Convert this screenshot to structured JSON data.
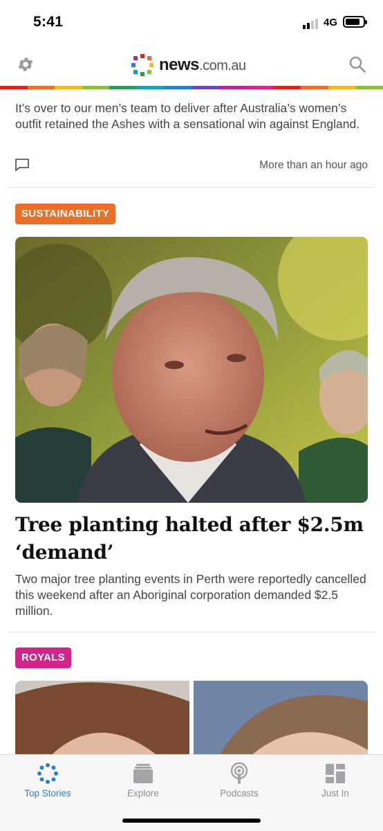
{
  "status_bar": {
    "time": "5:41",
    "network": "4G",
    "signal_bars_filled": 2,
    "battery_level": 0.85
  },
  "header": {
    "logo_main": "news",
    "logo_suffix": ".com.au",
    "rainbow_colors": [
      "#d9251d",
      "#e8702a",
      "#f2b825",
      "#8dbf3f",
      "#2c9a5c",
      "#1ba0b5",
      "#2c7fce",
      "#6a4bb5",
      "#b5268f",
      "#d0258b",
      "#d9251d",
      "#e8702a",
      "#f2b825",
      "#8dbf3f"
    ]
  },
  "article1": {
    "summary": "It’s over to our men’s team to deliver after Australia’s women’s outfit retained the Ashes with a sensational win against England.",
    "timestamp": "More than an hour ago"
  },
  "article2": {
    "tag": "SUSTAINABILITY",
    "tag_color": "#e8702a",
    "headline": "Tree planting halted after $2.5m ‘demand’",
    "standfirst": "Two major tree planting events in Perth were reportedly cancelled this weekend after an Aboriginal corporation demanded $2.5 million."
  },
  "article3": {
    "tag": "ROYALS",
    "tag_color": "#d0258b"
  },
  "tabbar": {
    "accent_color": "#2c7fce",
    "tabs": [
      {
        "label": "Top Stories",
        "icon": "top-stories-icon",
        "active": true
      },
      {
        "label": "Explore",
        "icon": "explore-icon",
        "active": false
      },
      {
        "label": "Podcasts",
        "icon": "podcasts-icon",
        "active": false
      },
      {
        "label": "Just In",
        "icon": "just-in-icon",
        "active": false
      }
    ]
  }
}
